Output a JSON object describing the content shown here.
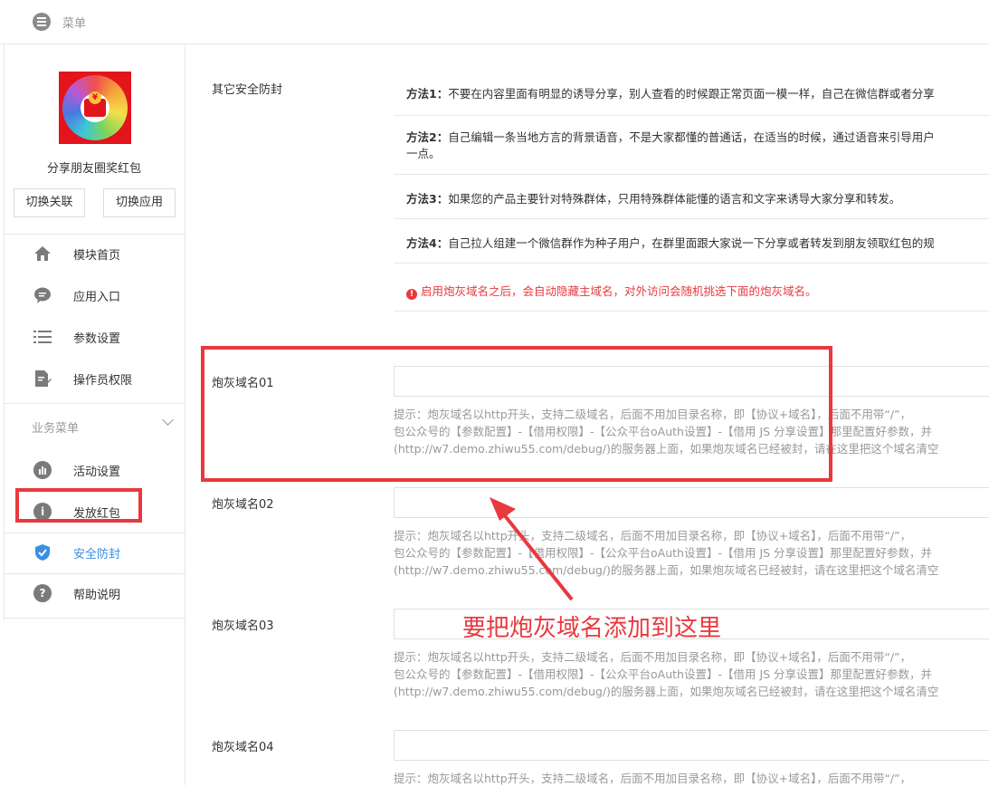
{
  "topbar": {
    "menu_label": "菜单"
  },
  "sidebar": {
    "app_name": "分享朋友圈奖红包",
    "logo_coin_symbol": "¥",
    "switch_link_button": "切换关联",
    "switch_app_button": "切换应用",
    "items": [
      {
        "label": "模块首页",
        "icon": "home-icon"
      },
      {
        "label": "应用入口",
        "icon": "chat-icon"
      },
      {
        "label": "参数设置",
        "icon": "list-icon"
      },
      {
        "label": "操作员权限",
        "icon": "document-edit-icon"
      }
    ],
    "section_label": "业务菜单",
    "business_items": [
      {
        "label": "活动设置",
        "icon": "chart-icon"
      },
      {
        "label": "发放红包",
        "icon": "info-icon"
      },
      {
        "label": "安全防封",
        "icon": "shield-check-icon",
        "active": true
      },
      {
        "label": "帮助说明",
        "icon": "question-icon"
      }
    ]
  },
  "main": {
    "other_security_label": "其它安全防封",
    "methods": [
      {
        "title": "方法1：",
        "text": "不要在内容里面有明显的诱导分享，别人查看的时候跟正常页面一模一样，自己在微信群或者分享"
      },
      {
        "title": "方法2：",
        "text": "自己编辑一条当地方言的背景语音，不是大家都懂的普通话，在适当的时候，通过语音来引导用户",
        "text2": "一点。"
      },
      {
        "title": "方法3：",
        "text": "如果您的产品主要针对特殊群体，只用特殊群体能懂的语言和文字来诱导大家分享和转发。"
      },
      {
        "title": "方法4：",
        "text": "自己拉人组建一个微信群作为种子用户，在群里面跟大家说一下分享或者转发到朋友领取红包的规"
      }
    ],
    "warning": "启用炮灰域名之后，会自动隐藏主域名，对外访问会随机挑选下面的炮灰域名。",
    "warning_icon": "!",
    "domains": [
      {
        "label": "炮灰域名01",
        "value": "",
        "hint1": "提示：炮灰域名以http开头，支持二级域名，后面不用加目录名称，即【协议+域名】，后面不用带“/”，",
        "hint2": "包公众号的【参数配置】-【借用权限】-【公众平台oAuth设置】-【借用 JS 分享设置】那里配置好参数，并",
        "hint3": "(http://w7.demo.zhiwu55.com/debug/)的服务器上面，如果炮灰域名已经被封，请在这里把这个域名清空"
      },
      {
        "label": "炮灰域名02",
        "value": "",
        "hint1": "提示：炮灰域名以http开头，支持二级域名，后面不用加目录名称，即【协议+域名】，后面不用带“/”，",
        "hint2": "包公众号的【参数配置】-【借用权限】-【公众平台oAuth设置】-【借用 JS 分享设置】那里配置好参数，并",
        "hint3": "(http://w7.demo.zhiwu55.com/debug/)的服务器上面，如果炮灰域名已经被封，请在这里把这个域名清空"
      },
      {
        "label": "炮灰域名03",
        "value": "",
        "hint1": "提示：炮灰域名以http开头，支持二级域名，后面不用加目录名称，即【协议+域名】，后面不用带“/”，",
        "hint2": "包公众号的【参数配置】-【借用权限】-【公众平台oAuth设置】-【借用 JS 分享设置】那里配置好参数，并",
        "hint3": "(http://w7.demo.zhiwu55.com/debug/)的服务器上面，如果炮灰域名已经被封，请在这里把这个域名清空"
      },
      {
        "label": "炮灰域名04",
        "value": "",
        "hint1": "提示：炮灰域名以http开头，支持二级域名，后面不用加目录名称，即【协议+域名】，后面不用带“/”，"
      }
    ]
  },
  "annotation": {
    "text": "要把炮灰域名添加到这里",
    "color": "#e8393e"
  },
  "colors": {
    "accent": "#3a8ee6",
    "annotation_red": "#e8393e"
  }
}
